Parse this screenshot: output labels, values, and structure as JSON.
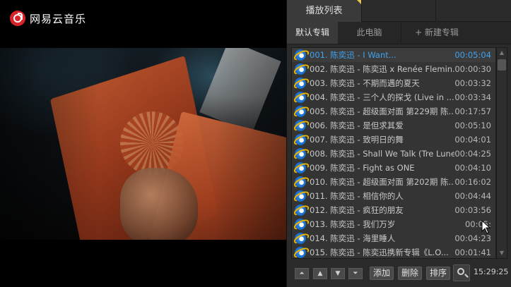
{
  "app": {
    "name": "网易云音乐",
    "brand_color": "#d9222a",
    "accent_color": "#3fa4f0"
  },
  "header": {
    "tabs": [
      {
        "label": "播放列表",
        "active": true
      },
      {
        "label": ""
      },
      {
        "label": ""
      }
    ]
  },
  "albums": {
    "default_label": "默认专辑",
    "pc_label": "此电脑",
    "new_label": "+ 新建专辑"
  },
  "playlist": {
    "items": [
      {
        "title": "001. 陈奕迅 - I Want...",
        "duration": "00:05:04",
        "playing": true
      },
      {
        "title": "002. 陈奕迅 - 陈奕迅 x Renée Flemin...",
        "duration": "00:00:30"
      },
      {
        "title": "003. 陈奕迅 - 不期而遇的夏天",
        "duration": "00:03:32"
      },
      {
        "title": "004. 陈奕迅 - 三个人的探戈 (Live in ...",
        "duration": "00:03:34"
      },
      {
        "title": "005. 陈奕迅 - 超级面对面 第229期 陈...",
        "duration": "00:17:57"
      },
      {
        "title": "006. 陈奕迅 - 是但求其爱",
        "duration": "00:05:10"
      },
      {
        "title": "007. 陈奕迅 - 致明日的舞",
        "duration": "00:04:01"
      },
      {
        "title": "008. 陈奕迅 - Shall We Talk (Tre Lune ...",
        "duration": "00:04:25"
      },
      {
        "title": "009. 陈奕迅 - Fight as ONE",
        "duration": "00:04:10"
      },
      {
        "title": "010. 陈奕迅 - 超级面对面 第202期 陈...",
        "duration": "00:16:02"
      },
      {
        "title": "011. 陈奕迅 - 相信你的人",
        "duration": "00:04:44"
      },
      {
        "title": "012. 陈奕迅 - 疯狂的朋友",
        "duration": "00:03:56"
      },
      {
        "title": "013. 陈奕迅 - 我们万岁",
        "duration": "00:05:"
      },
      {
        "title": "014. 陈奕迅 - 海里睡人",
        "duration": "00:04:23"
      },
      {
        "title": "015. 陈奕迅 - 陈奕迅携新专辑《L.O...",
        "duration": "00:01:41"
      }
    ]
  },
  "toolbar": {
    "move_top_icon": "move-to-top-icon",
    "move_up_icon": "move-up-icon",
    "move_down_icon": "move-down-icon",
    "move_bottom_icon": "move-to-bottom-icon",
    "add_label": "添加",
    "delete_label": "删除",
    "sort_label": "排序",
    "search_icon": "search-icon",
    "clock": "15:29:25"
  }
}
